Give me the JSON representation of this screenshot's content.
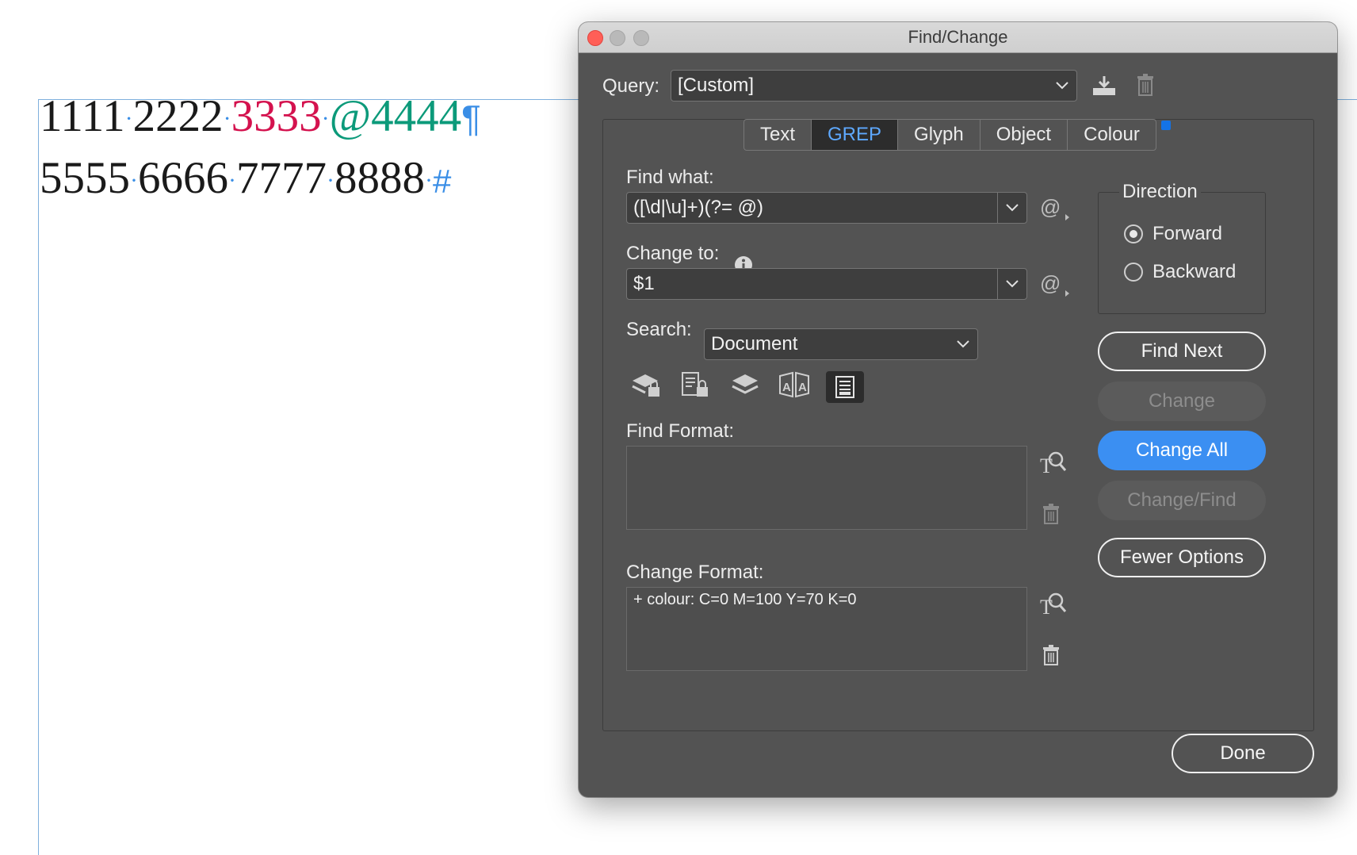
{
  "document": {
    "line1": [
      {
        "text": "1111",
        "style": "plain"
      },
      {
        "text": "·",
        "style": "dot"
      },
      {
        "text": "2222",
        "style": "plain"
      },
      {
        "text": "·",
        "style": "dot"
      },
      {
        "text": "3333",
        "style": "red"
      },
      {
        "text": "·",
        "style": "dot"
      },
      {
        "text": "@4444",
        "style": "green"
      },
      {
        "text": "¶",
        "style": "pilcrow"
      }
    ],
    "line2": [
      {
        "text": "5555",
        "style": "plain"
      },
      {
        "text": "·",
        "style": "dot"
      },
      {
        "text": "6666",
        "style": "plain"
      },
      {
        "text": "·",
        "style": "dot"
      },
      {
        "text": "7777",
        "style": "plain"
      },
      {
        "text": "·",
        "style": "dot"
      },
      {
        "text": "8888",
        "style": "plain"
      },
      {
        "text": "·",
        "style": "dot"
      },
      {
        "text": "#",
        "style": "hash"
      }
    ]
  },
  "dialog": {
    "title": "Find/Change",
    "query_label": "Query:",
    "query_value": "[Custom]",
    "tabs": [
      {
        "label": "Text",
        "active": false
      },
      {
        "label": "GREP",
        "active": true
      },
      {
        "label": "Glyph",
        "active": false
      },
      {
        "label": "Object",
        "active": false
      },
      {
        "label": "Colour",
        "active": false
      }
    ],
    "find_what_label": "Find what:",
    "find_what_value": "([\\d|\\u]+)(?= @)",
    "change_to_label": "Change to:",
    "change_to_value": "$1",
    "search_label": "Search:",
    "search_value": "Document",
    "find_format_label": "Find Format:",
    "find_format_value": "",
    "change_format_label": "Change Format:",
    "change_format_value": "+ colour: C=0 M=100 Y=70 K=0",
    "direction_label": "Direction",
    "direction_forward": "Forward",
    "direction_backward": "Backward",
    "buttons": {
      "find_next": "Find Next",
      "change": "Change",
      "change_all": "Change All",
      "change_find": "Change/Find",
      "fewer_options": "Fewer Options",
      "done": "Done"
    },
    "accent_color": "#3b8ff2"
  }
}
